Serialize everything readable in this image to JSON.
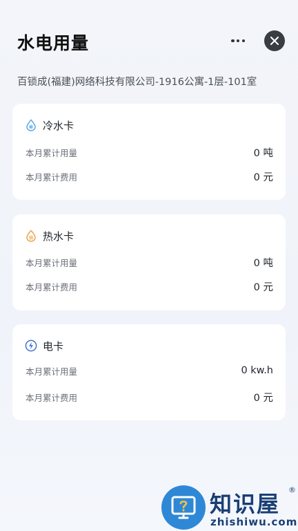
{
  "header": {
    "title": "水电用量",
    "more_icon": "more-horizontal-icon",
    "close_icon": "close-icon"
  },
  "address": "百锁成(福建)网络科技有限公司-1916公寓-1层-101室",
  "cards": [
    {
      "title": "冷水卡",
      "icon": "cold-water-snowflake-icon",
      "accent": "#5aa9e6",
      "usage_label": "本月累计用量",
      "usage_value": "0 吨",
      "cost_label": "本月累计费用",
      "cost_value": "0 元"
    },
    {
      "title": "热水卡",
      "icon": "hot-water-flame-icon",
      "accent": "#e9a44a",
      "usage_label": "本月累计用量",
      "usage_value": "0 吨",
      "cost_label": "本月累计费用",
      "cost_value": "0 元"
    },
    {
      "title": "电卡",
      "icon": "electricity-bolt-icon",
      "accent": "#3f6fd1",
      "usage_label": "本月累计用量",
      "usage_value": "0 kw.h",
      "cost_label": "本月累计费用",
      "cost_value": "0 元"
    }
  ],
  "watermark": {
    "brand": "知识屋",
    "registered": "®",
    "url": "zhishiwu.com",
    "icon": "help-monitor-logo-icon"
  }
}
